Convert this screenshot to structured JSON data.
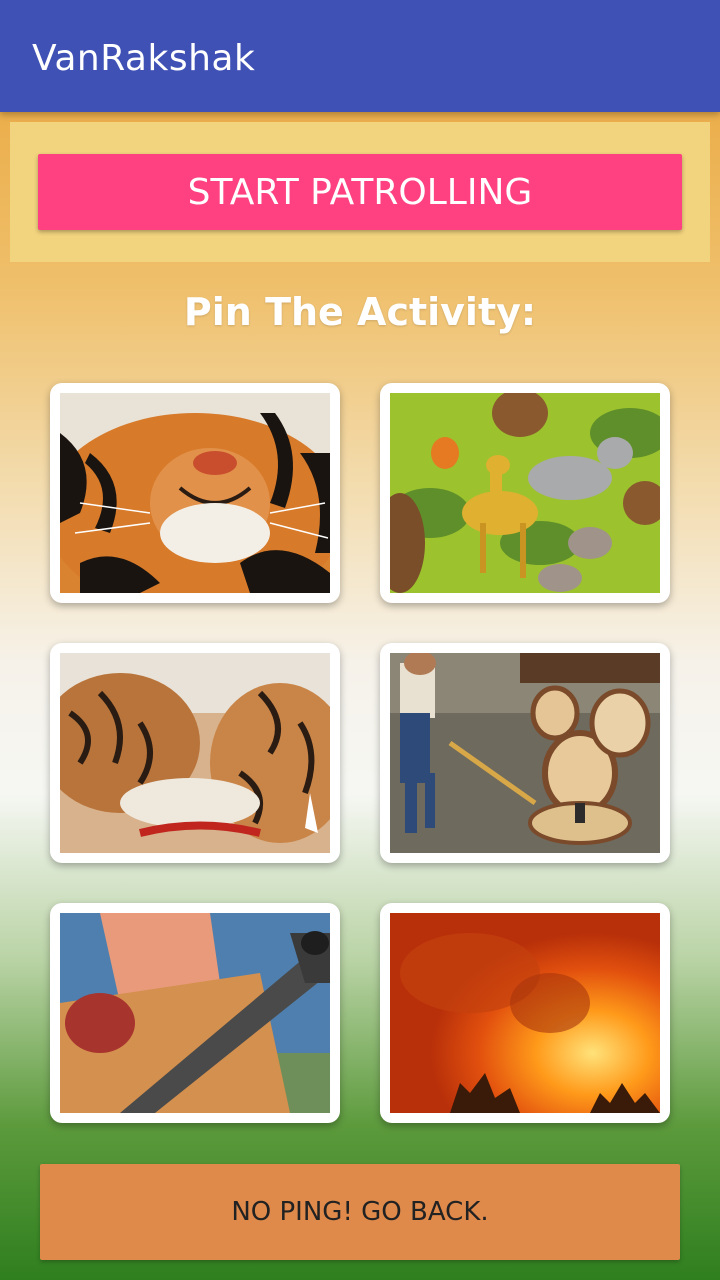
{
  "app_bar": {
    "title": "VanRakshak"
  },
  "start_button": {
    "label": "START PATROLLING"
  },
  "pin_section": {
    "heading": "Pin The Activity:",
    "tiles": [
      {
        "icon": "tiger-face-image"
      },
      {
        "icon": "cartoon-animals-image"
      },
      {
        "icon": "tiger-fight-image"
      },
      {
        "icon": "tree-cutting-image"
      },
      {
        "icon": "hunter-gun-image"
      },
      {
        "icon": "forest-fire-image"
      }
    ]
  },
  "back_button": {
    "label": "NO PING! GO BACK."
  },
  "colors": {
    "app_bar": "#3f51b5",
    "accent": "#ff4081",
    "start_panel": "#f2d47e",
    "back_button": "#df8a4b"
  }
}
